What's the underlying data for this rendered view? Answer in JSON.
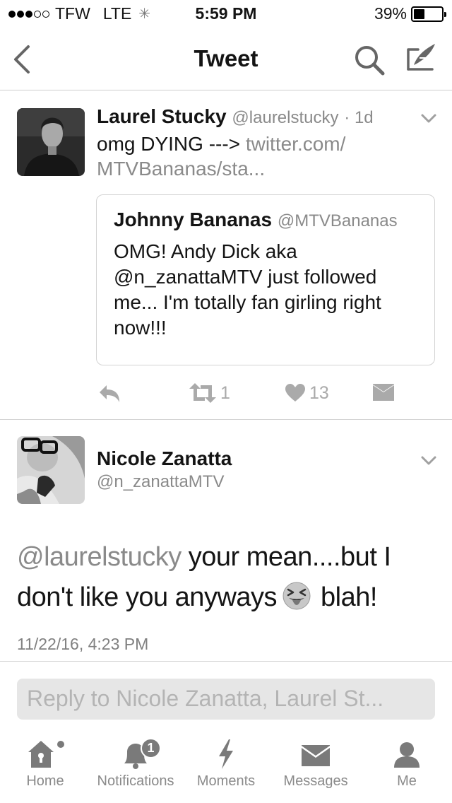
{
  "status_bar": {
    "carrier": "TFW",
    "network": "LTE",
    "time": "5:59 PM",
    "battery": "39%",
    "battery_level": 0.39
  },
  "nav": {
    "title": "Tweet",
    "back_icon": "chevron-left-icon",
    "search_icon": "search-icon",
    "compose_icon": "compose-icon"
  },
  "tweet": {
    "author_name": "Laurel Stucky",
    "author_handle": "@laurelstucky",
    "age": "· 1d",
    "text": "omg DYING --->",
    "link": "twitter.com/ MTVBananas/sta...",
    "quoted": {
      "name": "Johnny Bananas",
      "handle": "@MTVBananas",
      "text": "OMG! Andy Dick aka @n_zanattaMTV  just followed me... I'm totally fan girling right now!!!"
    },
    "retweets": "1",
    "likes": "13"
  },
  "reply_tweet": {
    "author_name": "Nicole Zanatta",
    "author_handle": "@n_zanattaMTV",
    "mention": "@laurelstucky",
    "text_part1": "your mean....but I don't like you anyways",
    "emoji": "squinting-tongue-emoji",
    "text_part2": "blah!",
    "timestamp": "11/22/16, 4:23 PM"
  },
  "reply_box": {
    "placeholder": "Reply to Nicole Zanatta, Laurel St..."
  },
  "tab_bar": {
    "items": [
      {
        "label": "Home",
        "icon": "home-icon"
      },
      {
        "label": "Notifications",
        "icon": "bell-icon",
        "badge": "1"
      },
      {
        "label": "Moments",
        "icon": "lightning-icon"
      },
      {
        "label": "Messages",
        "icon": "envelope-icon"
      },
      {
        "label": "Me",
        "icon": "person-icon"
      }
    ]
  }
}
